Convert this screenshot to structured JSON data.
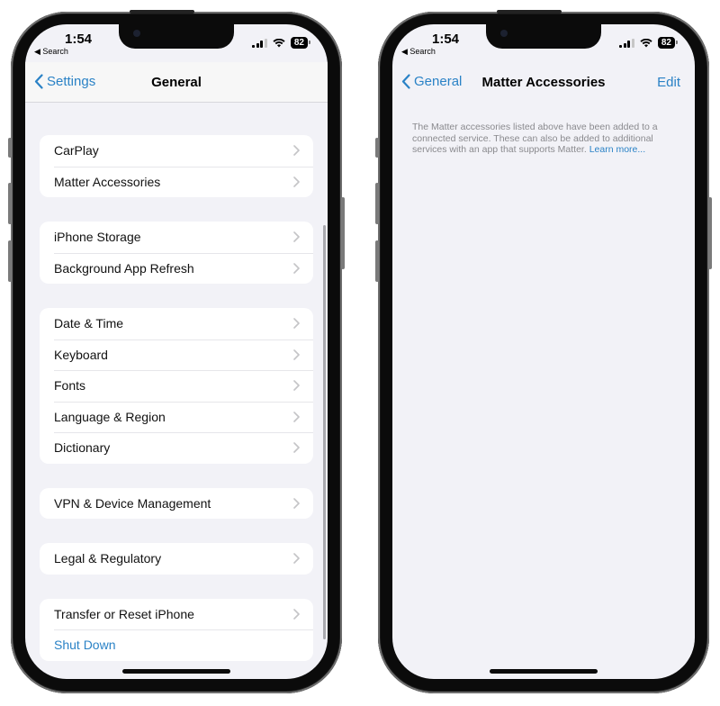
{
  "left_phone": {
    "status_bar": {
      "time": "1:54",
      "back_app": "◀ Search",
      "battery": "82"
    },
    "nav": {
      "back_label": "Settings",
      "title": "General"
    },
    "groups": [
      [
        {
          "label": "CarPlay",
          "chevron": true
        },
        {
          "label": "Matter Accessories",
          "chevron": true
        }
      ],
      [
        {
          "label": "iPhone Storage",
          "chevron": true
        },
        {
          "label": "Background App Refresh",
          "chevron": true
        }
      ],
      [
        {
          "label": "Date & Time",
          "chevron": true
        },
        {
          "label": "Keyboard",
          "chevron": true
        },
        {
          "label": "Fonts",
          "chevron": true
        },
        {
          "label": "Language & Region",
          "chevron": true
        },
        {
          "label": "Dictionary",
          "chevron": true
        }
      ],
      [
        {
          "label": "VPN & Device Management",
          "chevron": true
        }
      ],
      [
        {
          "label": "Legal & Regulatory",
          "chevron": true
        }
      ],
      [
        {
          "label": "Transfer or Reset iPhone",
          "chevron": true
        },
        {
          "label": "Shut Down",
          "chevron": false,
          "link": true
        }
      ]
    ]
  },
  "right_phone": {
    "status_bar": {
      "time": "1:54",
      "back_app": "◀ Search",
      "battery": "82"
    },
    "nav": {
      "back_label": "General",
      "title": "Matter Accessories",
      "edit_label": "Edit"
    },
    "note": {
      "text": "The Matter accessories listed above have been added to a connected service. These can also be added to additional services with an app that supports Matter. ",
      "link": "Learn more..."
    }
  },
  "colors": {
    "accent": "#2a82c6",
    "background": "#f2f2f7",
    "frame": "#0b0b0b"
  }
}
